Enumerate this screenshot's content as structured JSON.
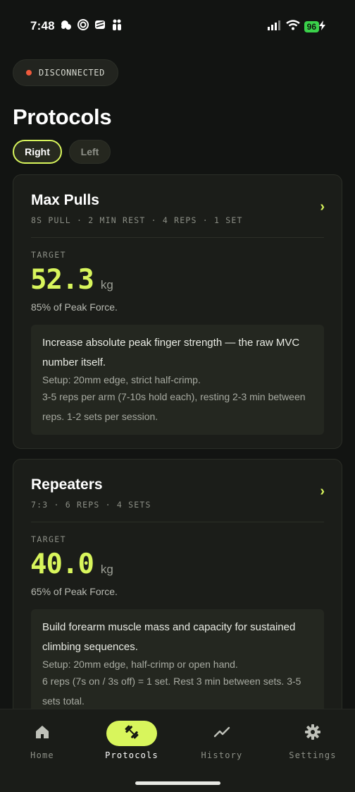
{
  "status_bar": {
    "time": "7:48",
    "battery": "96"
  },
  "connection": {
    "status": "DISCONNECTED",
    "status_color": "#ef5a3c"
  },
  "page": {
    "title": "Protocols"
  },
  "side_toggle": {
    "options": [
      {
        "label": "Right",
        "selected": true
      },
      {
        "label": "Left",
        "selected": false
      }
    ]
  },
  "protocols": [
    {
      "name": "Max Pulls",
      "meta": "8S PULL · 2 MIN REST · 4 REPS · 1 SET",
      "target_label": "TARGET",
      "target_value": "52.3",
      "target_unit": "kg",
      "target_sub": "85% of Peak Force.",
      "description": "Increase absolute peak finger strength — the raw MVC number itself.",
      "setup": "Setup: 20mm edge, strict half-crimp.",
      "detail": "3-5 reps per arm (7-10s hold each), resting 2-3 min between reps. 1-2 sets per session."
    },
    {
      "name": "Repeaters",
      "meta": "7:3 · 6 REPS · 4 SETS",
      "target_label": "TARGET",
      "target_value": "40.0",
      "target_unit": "kg",
      "target_sub": "65% of Peak Force.",
      "description": "Build forearm muscle mass and capacity for sustained climbing sequences.",
      "setup": "Setup: 20mm edge, half-crimp or open hand.",
      "detail": "6 reps (7s on / 3s off) = 1 set. Rest 3 min between sets. 3-5 sets total."
    }
  ],
  "nav": {
    "items": [
      {
        "label": "Home",
        "icon": "home-icon",
        "active": false
      },
      {
        "label": "Protocols",
        "icon": "dumbbell-icon",
        "active": true
      },
      {
        "label": "History",
        "icon": "trend-line-icon",
        "active": false
      },
      {
        "label": "Settings",
        "icon": "gear-icon",
        "active": false
      }
    ]
  },
  "colors": {
    "accent": "#d8f55c",
    "background": "#121412",
    "card": "#1b1d19"
  }
}
